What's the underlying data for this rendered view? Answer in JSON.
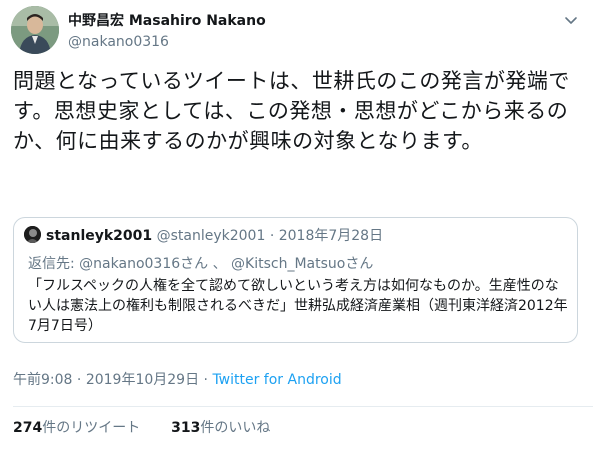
{
  "author": {
    "display_name": "中野昌宏 Masahiro Nakano",
    "handle": "@nakano0316"
  },
  "tweet": {
    "text": "問題となっているツイートは、世耕氏のこの発言が発端です。思想史家としては、この発想・思想がどこから来るのか、何に由来するのかが興味の対象となります。"
  },
  "quoted": {
    "name": "stanleyk2001",
    "handle": "@stanleyk2001",
    "separator": "·",
    "date": "2018年7月28日",
    "reply_prefix": "返信先: ",
    "reply_to_1": "@nakano0316さん",
    "reply_sep": " 、 ",
    "reply_to_2": "@Kitsch_Matsuoさん",
    "text": "「フルスペックの人権を全て認めて欲しいという考え方は如何なものか。生産性のない人は憲法上の権利も制限されるべきだ」世耕弘成経済産業相（週刊東洋経済2012年7月7日号）"
  },
  "meta": {
    "time": "午前9:08",
    "separator_1": " · ",
    "date": "2019年10月29日",
    "separator_2": " · ",
    "source": "Twitter for Android"
  },
  "stats": {
    "retweets_count": "274",
    "retweets_label": "件のリツイート",
    "likes_count": "313",
    "likes_label": "件のいいね"
  },
  "icons": {
    "caret": "chevron-down-icon",
    "avatar": "profile-photo"
  },
  "colors": {
    "link": "#1da1f2",
    "muted": "#657786",
    "text": "#14171a",
    "border": "#ccd6dd"
  }
}
